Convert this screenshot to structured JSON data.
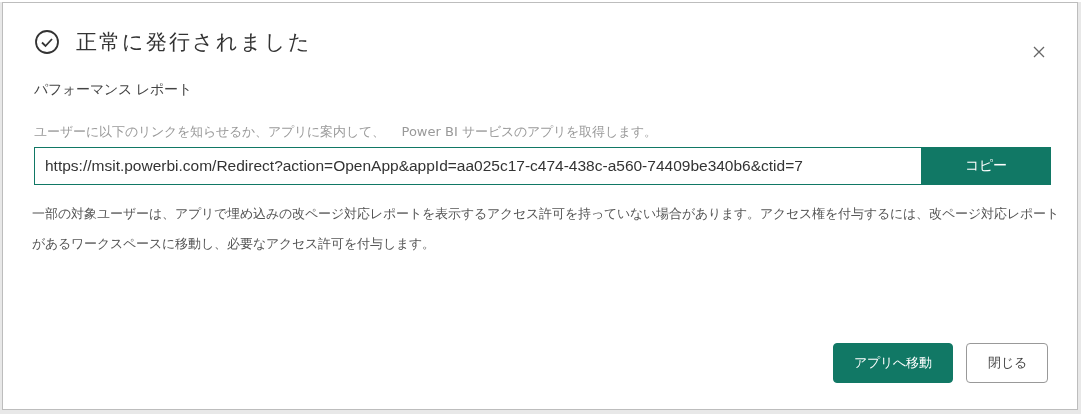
{
  "dialog": {
    "title": "正常に発行されました",
    "subtitle": "パフォーマンス レポート",
    "instruction": "ユーザーに以下のリンクを知らせるか、アプリに案内して、    Power BI サービスのアプリを取得します。",
    "link_field": {
      "value": "https://msit.powerbi.com/Redirect?action=OpenApp&appId=aa025c17-c474-438c-a560-74409be340b6&ctid=7"
    },
    "copy_button": "コピー",
    "note": "一部の対象ユーザーは、アプリで埋め込みの改ページ対応レポートを表示するアクセス許可を持っていない場合があります。アクセス権を付与するには、改ページ対応レポートがあるワークスペースに移動し、必要なアクセス許可を付与します。",
    "buttons": [
      {
        "label": "アプリへ移動",
        "kind": "primary"
      },
      {
        "label": "閉じる",
        "kind": "secondary"
      }
    ]
  }
}
